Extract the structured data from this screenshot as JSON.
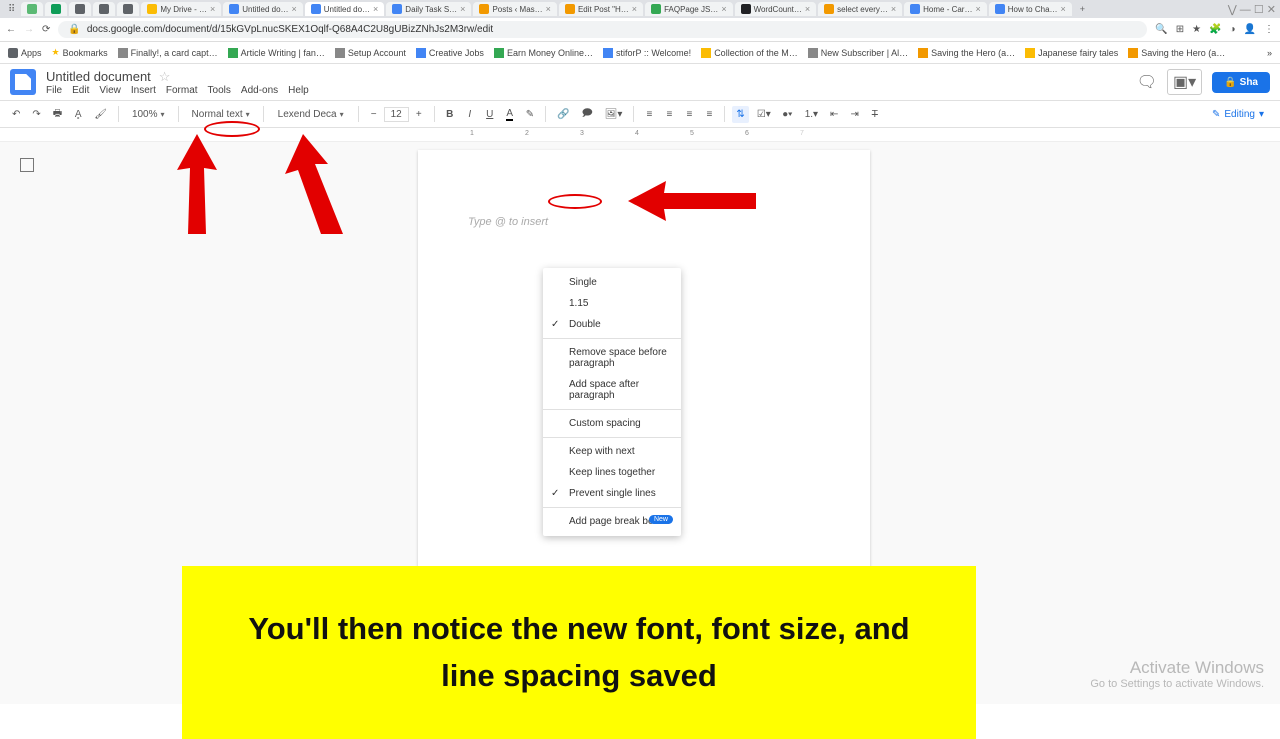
{
  "browser": {
    "tabs": [
      {
        "label": "",
        "fav": "#5bb974"
      },
      {
        "label": "",
        "fav": "#0f9d58"
      },
      {
        "label": "",
        "fav": "#5f6368"
      },
      {
        "label": "",
        "fav": "#5f6368"
      },
      {
        "label": "",
        "fav": "#5f6368"
      },
      {
        "label": "My Drive - …",
        "fav": "#fbbc04"
      },
      {
        "label": "Untitled do…",
        "fav": "#4285f4"
      },
      {
        "label": "Untitled do…",
        "fav": "#4285f4",
        "active": true
      },
      {
        "label": "Daily Task S…",
        "fav": "#4285f4"
      },
      {
        "label": "Posts ‹ Mas…",
        "fav": "#f29900"
      },
      {
        "label": "Edit Post \"H…",
        "fav": "#f29900"
      },
      {
        "label": "FAQPage JS…",
        "fav": "#34a853"
      },
      {
        "label": "WordCount…",
        "fav": "#202124"
      },
      {
        "label": "select every…",
        "fav": "#f29900"
      },
      {
        "label": "Home - Car…",
        "fav": "#4285f4"
      },
      {
        "label": "How to Cha…",
        "fav": "#4285f4"
      }
    ],
    "url": "docs.google.com/document/d/15kGVpLnucSKEX1Oqlf-Q68A4C2U8gUBizZNhJs2M3rw/edit",
    "bookmarks": [
      {
        "label": "Apps",
        "color": "#5f6368"
      },
      {
        "label": "Bookmarks",
        "color": "#fbbc04"
      },
      {
        "label": "Finally!, a card capt…",
        "color": "#5f6368"
      },
      {
        "label": "Article Writing | fan…",
        "color": "#34a853"
      },
      {
        "label": "Setup Account",
        "color": "#5f6368"
      },
      {
        "label": "Creative Jobs",
        "color": "#4285f4"
      },
      {
        "label": "Earn Money Online…",
        "color": "#34a853"
      },
      {
        "label": "stiforP :: Welcome!",
        "color": "#4285f4"
      },
      {
        "label": "Collection of the M…",
        "color": "#fbbc04"
      },
      {
        "label": "New Subscriber | Al…",
        "color": "#5f6368"
      },
      {
        "label": "Saving the Hero (a…",
        "color": "#f29900"
      },
      {
        "label": "Japanese fairy tales",
        "color": "#fbbc04"
      },
      {
        "label": "Saving the Hero (a…",
        "color": "#f29900"
      }
    ]
  },
  "docs": {
    "title": "Untitled document",
    "menus": [
      "File",
      "Edit",
      "View",
      "Insert",
      "Format",
      "Tools",
      "Add-ons",
      "Help"
    ],
    "share": "Sha"
  },
  "toolbar": {
    "zoom": "100%",
    "style": "Normal text",
    "font": "Lexend Deca",
    "size": "12",
    "editing": "Editing"
  },
  "ruler_marks": [
    "1",
    "2",
    "3",
    "4",
    "5",
    "6",
    "7"
  ],
  "page": {
    "placeholder": "Type @ to insert"
  },
  "dropdown": {
    "items": [
      {
        "label": "Single"
      },
      {
        "label": "1.15"
      },
      {
        "label": "Double",
        "checked": true
      }
    ],
    "group2": [
      {
        "label": "Remove space before paragraph"
      },
      {
        "label": "Add space after paragraph"
      }
    ],
    "group3": [
      {
        "label": "Custom spacing"
      }
    ],
    "group4": [
      {
        "label": "Keep with next"
      },
      {
        "label": "Keep lines together"
      },
      {
        "label": "Prevent single lines",
        "checked": true
      }
    ],
    "group5": [
      {
        "label": "Add page break before",
        "new": "New"
      }
    ]
  },
  "annotation": "You'll then notice the new font, font size, and line spacing saved",
  "watermark": {
    "l1": "Activate Windows",
    "l2": "Go to Settings to activate Windows."
  }
}
